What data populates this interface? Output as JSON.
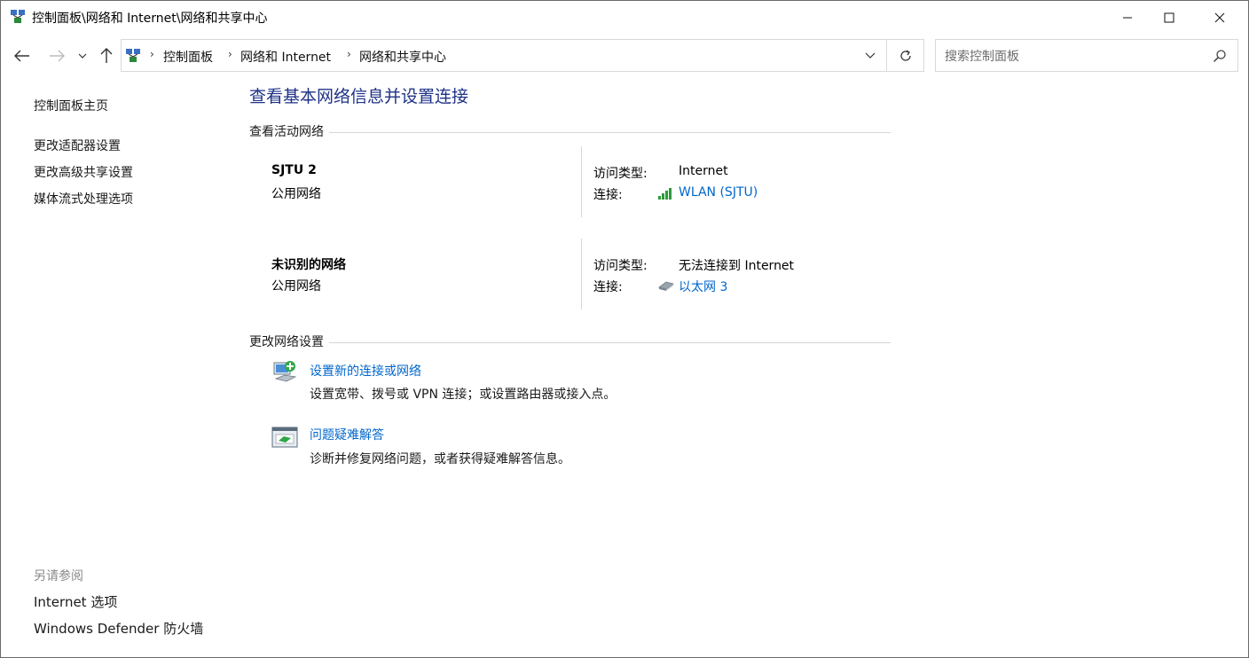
{
  "window": {
    "title": "控制面板\\网络和 Internet\\网络和共享中心"
  },
  "address": {
    "crumbs": [
      "控制面板",
      "网络和 Internet",
      "网络和共享中心"
    ]
  },
  "search": {
    "placeholder": "搜索控制面板"
  },
  "sidebar": {
    "home": "控制面板主页",
    "links": [
      "更改适配器设置",
      "更改高级共享设置",
      "媒体流式处理选项"
    ],
    "see_also_title": "另请参阅",
    "see_also": [
      "Internet 选项",
      "Windows Defender 防火墙"
    ]
  },
  "main": {
    "heading": "查看基本网络信息并设置连接",
    "active_title": "查看活动网络",
    "access_label": "访问类型:",
    "connection_label": "连接:",
    "networks": [
      {
        "name": "SJTU 2",
        "type": "公用网络",
        "access": "Internet",
        "connection": "WLAN (SJTU)",
        "icon": "wifi-signal-icon"
      },
      {
        "name": "未识别的网络",
        "type": "公用网络",
        "access": "无法连接到 Internet",
        "connection": "以太网 3",
        "icon": "ethernet-icon"
      }
    ],
    "change_title": "更改网络设置",
    "tasks": [
      {
        "title": "设置新的连接或网络",
        "desc": "设置宽带、拨号或 VPN 连接；或设置路由器或接入点。",
        "icon": "new-connection-icon"
      },
      {
        "title": "问题疑难解答",
        "desc": "诊断并修复网络问题，或者获得疑难解答信息。",
        "icon": "troubleshoot-icon"
      }
    ]
  },
  "colors": {
    "link": "#0066cc",
    "heading": "#1e3287",
    "rule": "#d6d6d6"
  }
}
